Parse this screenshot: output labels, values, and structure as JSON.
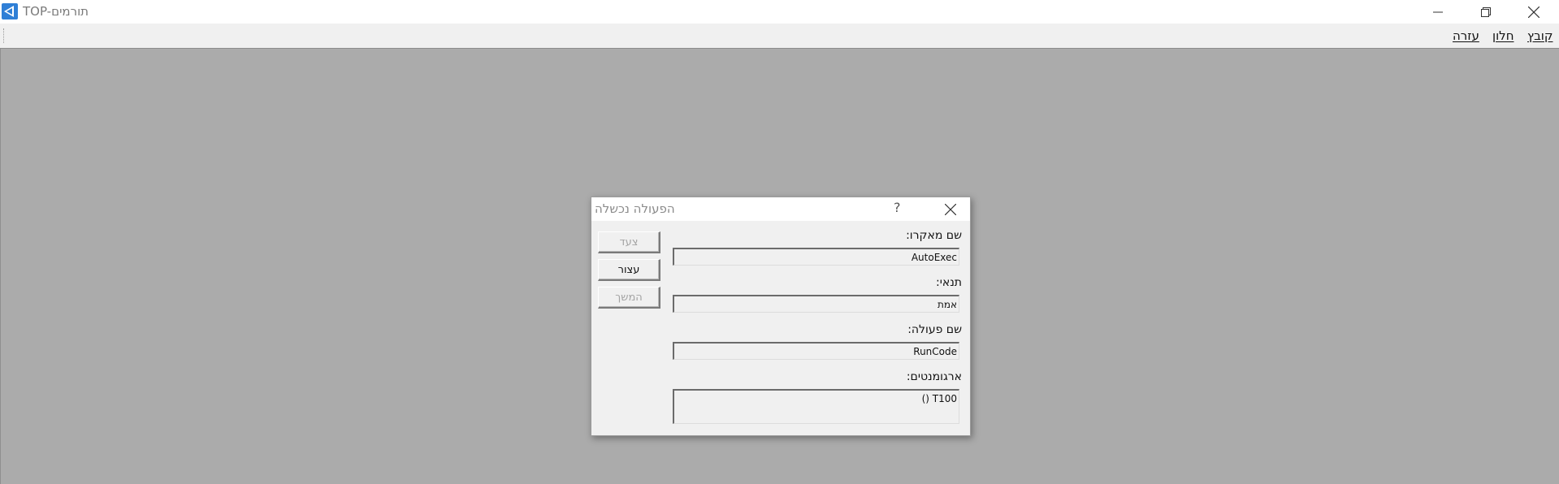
{
  "window": {
    "title": "TOP-תורמים",
    "icon": "app-logo-icon",
    "controls": [
      "minimize-icon",
      "restore-icon",
      "close-icon"
    ]
  },
  "menubar": {
    "items": [
      {
        "label": "קובץ"
      },
      {
        "label": "חלון"
      },
      {
        "label": "עזרה"
      }
    ]
  },
  "dialog": {
    "title": "הפעולה נכשלה",
    "help_label": "?",
    "fields": {
      "macro_name": {
        "label": "שם מאקרו:",
        "value": "AutoExec"
      },
      "condition": {
        "label": "תנאי:",
        "value": "אמת"
      },
      "action_name": {
        "label": "שם פעולה:",
        "value": "RunCode"
      },
      "arguments": {
        "label": "ארגומנטים:",
        "value": "T100 ()"
      }
    },
    "buttons": {
      "step": {
        "label": "צעד",
        "enabled": false
      },
      "stop": {
        "label": "עצור",
        "enabled": true
      },
      "continue": {
        "label": "המשך",
        "enabled": false
      }
    }
  },
  "colors": {
    "workspace": "#ababab",
    "menubar": "#f0f0f0",
    "dialog_bg": "#f0f0f0",
    "app_icon_blue": "#2f7fd6"
  }
}
